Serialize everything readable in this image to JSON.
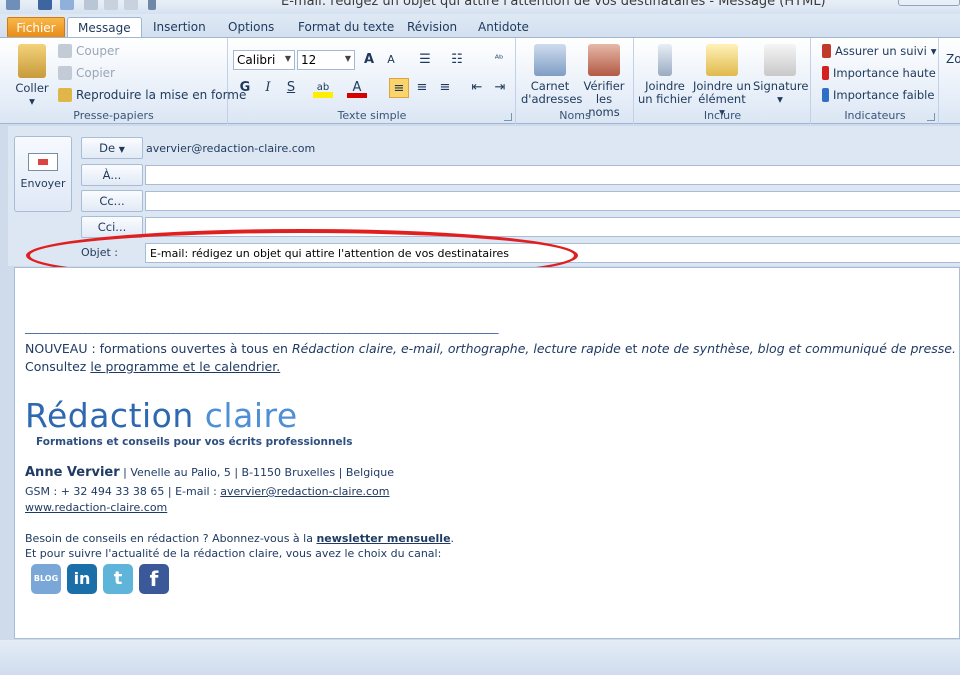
{
  "window": {
    "title": "E-mail: rédigez un objet qui attire l'attention de vos destinataires - Message (HTML)"
  },
  "tabs": [
    {
      "label": "Fichier"
    },
    {
      "label": "Message"
    },
    {
      "label": "Insertion"
    },
    {
      "label": "Options"
    },
    {
      "label": "Format du texte"
    },
    {
      "label": "Révision"
    },
    {
      "label": "Antidote"
    }
  ],
  "ribbon": {
    "clipboard": {
      "label": "Presse-papiers",
      "paste": "Coller",
      "cut": "Couper",
      "copy": "Copier",
      "format_painter": "Reproduire la mise en forme"
    },
    "basic_text": {
      "label": "Texte simple",
      "font": "Calibri",
      "size": "12",
      "bold": "G",
      "italic": "I",
      "underline": "S"
    },
    "names": {
      "label": "Noms",
      "address_book": "Carnet d'adresses",
      "check_names": "Vérifier les noms"
    },
    "include": {
      "label": "Inclure",
      "attach_file": "Joindre un fichier",
      "attach_item": "Joindre un élément",
      "signature": "Signature"
    },
    "tags": {
      "label": "Indicateurs",
      "follow_up": "Assurer un suivi",
      "high_importance": "Importance haute",
      "low_importance": "Importance faible"
    },
    "zoom_partial": "Zo"
  },
  "compose": {
    "send": "Envoyer",
    "from_label": "De",
    "from_value": "avervier@redaction-claire.com",
    "to_label": "À...",
    "cc_label": "Cc...",
    "bcc_label": "Cci...",
    "subject_label": "Objet :",
    "subject_value": "E-mail: rédigez un objet qui attire l'attention de vos destinataires"
  },
  "body": {
    "separator": "______________________________________________________________________________________",
    "news_prefix": "NOUVEAU : formations ouvertes à tous en ",
    "news_topics": "Rédaction claire, e-mail, orthographe, lecture rapide",
    "news_and": " et ",
    "news_topics2": "note de synthèse, blog et communiqué de presse.",
    "consult_prefix": "Consultez ",
    "program_link": "le programme et le calendrier.",
    "logo_main": "Rédaction",
    "logo_second": "claire",
    "logo_sub": "Formations et conseils pour vos écrits professionnels",
    "name": "Anne Vervier",
    "address": "| Venelle au Palio, 5 | B-1150 Bruxelles | Belgique",
    "gsm": "GSM : + 32 494 33 38 65 | E-mail : ",
    "email_link": "avervier@redaction-claire.com",
    "website": "www.redaction-claire.com",
    "newsletter_prefix": "Besoin de conseils en rédaction ? Abonnez-vous à la ",
    "newsletter_link": "newsletter mensuelle",
    "newsletter_suffix": ".",
    "channels": "Et pour suivre l'actualité de la rédaction claire, vous avez le choix du canal:",
    "social": [
      {
        "name": "blog-icon",
        "label": "BLOG",
        "color": "#7aa7d8"
      },
      {
        "name": "linkedin-icon",
        "label": "in",
        "color": "#1b6fa8"
      },
      {
        "name": "twitter-icon",
        "label": "t",
        "color": "#5eb4d9"
      },
      {
        "name": "facebook-icon",
        "label": "f",
        "color": "#3b5998"
      }
    ]
  }
}
